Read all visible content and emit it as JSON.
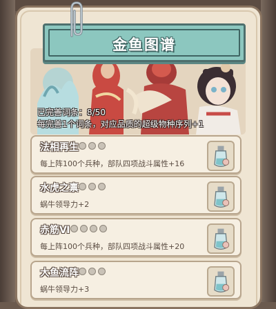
{
  "header": {
    "title": "金鱼图谱"
  },
  "progress": {
    "line1": "已完善词条：8/50",
    "line2": "每完善1个词条，对应品质的超级物种序列+1"
  },
  "entries": [
    {
      "title": "法相再生",
      "dots": 3,
      "desc": "每上阵100个兵种，部队四项战斗属性+16"
    },
    {
      "title": "水虎之禀",
      "dots": 3,
      "desc": "蜗牛领导力+2"
    },
    {
      "title": "赤筋Ⅵ",
      "dots": 4,
      "desc": "每上阵100个兵种，部队四项战斗属性+20"
    },
    {
      "title": "大鱼流阵",
      "dots": 3,
      "desc": "蜗牛领导力+3"
    }
  ],
  "colors": {
    "banner": "#8cc7bf",
    "banner_border": "#4d6f6d",
    "card": "#efe5d3"
  },
  "icons": {
    "clip": "paperclip-icon",
    "entry": "potion-bottle-icon"
  }
}
